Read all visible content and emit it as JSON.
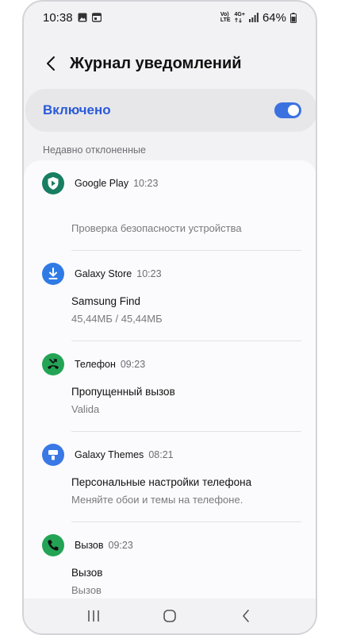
{
  "status_bar": {
    "time": "10:38",
    "network_top": "Vo)",
    "network_bottom": "LTE",
    "network_gen": "4G+",
    "battery": "64%"
  },
  "header": {
    "title": "Журнал уведомлений"
  },
  "toggle": {
    "label": "Включено",
    "state": "on",
    "accent_color": "#3b72e0"
  },
  "section": {
    "title": "Недавно отклоненные"
  },
  "notifications": [
    {
      "app": "Google Play",
      "time": "10:23",
      "title": "",
      "subtitle": "Проверка безопасности устройства",
      "icon": "google-play-protect-icon",
      "icon_color": "#177e62"
    },
    {
      "app": "Galaxy Store",
      "time": "10:23",
      "title": "Samsung Find",
      "subtitle": "45,44МБ / 45,44МБ",
      "icon": "download-icon",
      "icon_color": "#2f7ae5"
    },
    {
      "app": "Телефон",
      "time": "09:23",
      "title": "Пропущенный вызов",
      "subtitle": "Valida",
      "icon": "missed-call-icon",
      "icon_color": "#23a455"
    },
    {
      "app": "Galaxy Themes",
      "time": "08:21",
      "title": "Персональные настройки телефона",
      "subtitle": "Меняйте обои и темы на телефоне.",
      "icon": "themes-brush-icon",
      "icon_color": "#3a78e6"
    },
    {
      "app": "Вызов",
      "time": "09:23",
      "title": "Вызов",
      "subtitle": "Вызов",
      "icon": "phone-icon",
      "icon_color": "#23a455"
    }
  ],
  "nav": {
    "recents": "recents-icon",
    "home": "home-icon",
    "back": "back-icon"
  }
}
